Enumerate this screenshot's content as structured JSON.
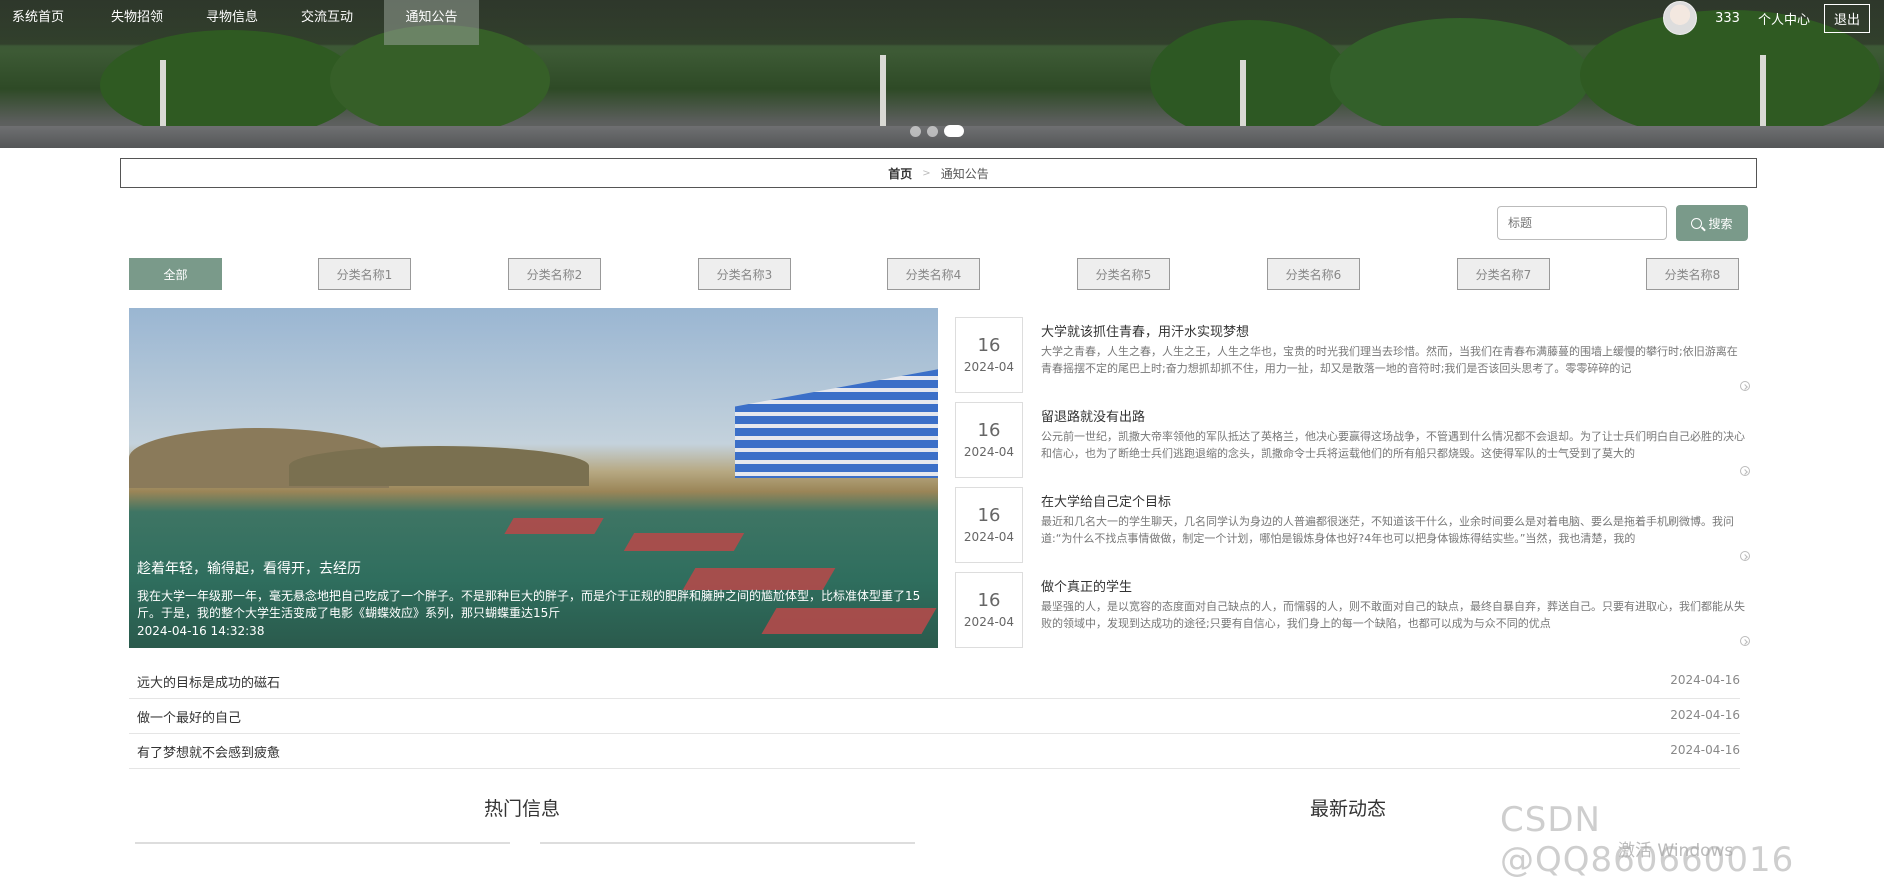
{
  "nav": {
    "items": [
      "系统首页",
      "失物招领",
      "寻物信息",
      "交流互动",
      "通知公告"
    ],
    "active_index": 4,
    "user_name": "333",
    "user_center_label": "个人中心",
    "logout_label": "退出"
  },
  "carousel": {
    "dot_count": 3,
    "active_index": 2
  },
  "breadcrumb": {
    "home": "首页",
    "separator": ">",
    "current": "通知公告"
  },
  "search": {
    "placeholder": "标题",
    "button_label": "搜索"
  },
  "categories": [
    "全部",
    "分类名称1",
    "分类名称2",
    "分类名称3",
    "分类名称4",
    "分类名称5",
    "分类名称6",
    "分类名称7",
    "分类名称8"
  ],
  "featured": {
    "title": "趁着年轻，输得起，看得开，去经历",
    "description": "我在大学一年级那一年，毫无悬念地把自己吃成了一个胖子。不是那种巨大的胖子，而是介于正规的肥胖和臃肿之间的尴尬体型，比标准体型重了15斤。于是，我的整个大学生活变成了电影《蝴蝶效应》系列，那只蝴蝶重达15斤",
    "time": "2024-04-16 14:32:38"
  },
  "news": [
    {
      "day": "16",
      "ym": "2024-04",
      "title": "大学就该抓住青春，用汗水实现梦想",
      "desc": "大学之青春，人生之春，人生之王，人生之华也，宝贵的时光我们理当去珍惜。然而，当我们在青春布满藤蔓的围墙上缓慢的攀行时;依旧游离在青春摇摆不定的尾巴上时;奋力想抓却抓不住，用力一扯，却又是散落一地的音符时;我们是否该回头思考了。零零碎碎的记"
    },
    {
      "day": "16",
      "ym": "2024-04",
      "title": "留退路就没有出路",
      "desc": "公元前一世纪，凯撒大帝率领他的军队抵达了英格兰，他决心要赢得这场战争，不管遇到什么情况都不会退却。为了让士兵们明白自己必胜的决心和信心，也为了断绝士兵们逃跑退缩的念头，凯撒命令士兵将运载他们的所有船只都烧毁。这使得军队的士气受到了莫大的"
    },
    {
      "day": "16",
      "ym": "2024-04",
      "title": "在大学给自己定个目标",
      "desc": "最近和几名大一的学生聊天，几名同学认为身边的人普遍都很迷茫，不知道该干什么，业余时间要么是对着电脑、要么是拖着手机刷微博。我问道:“为什么不找点事情做做，制定一个计划，哪怕是锻炼身体也好?4年也可以把身体锻炼得结实些。”当然，我也清楚，我的"
    },
    {
      "day": "16",
      "ym": "2024-04",
      "title": "做个真正的学生",
      "desc": "最坚强的人，是以宽容的态度面对自己缺点的人，而懦弱的人，则不敢面对自己的缺点，最终自暴自弃，葬送自己。只要有进取心，我们都能从失败的领域中，发现到达成功的途径;只要有自信心，我们身上的每一个缺陷，也都可以成为与众不同的优点"
    }
  ],
  "list": [
    {
      "title": "远大的目标是成功的磁石",
      "date": "2024-04-16"
    },
    {
      "title": "做一个最好的自己",
      "date": "2024-04-16"
    },
    {
      "title": "有了梦想就不会感到疲惫",
      "date": "2024-04-16"
    }
  ],
  "sections": {
    "hot": "热门信息",
    "latest": "最新动态"
  },
  "watermark": {
    "csdn": "CSDN @QQ860660016",
    "windows": "激活 Windows"
  },
  "colors": {
    "accent": "#7a9a8a",
    "nav_bg": "rgba(40,45,35,0.6)"
  }
}
